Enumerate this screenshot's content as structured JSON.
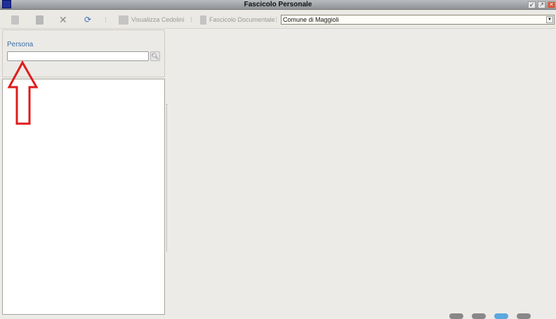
{
  "window": {
    "title": "Fascicolo Personale",
    "buttons": [
      "minimize",
      "maximize",
      "close"
    ]
  },
  "toolbar": {
    "new": "new-icon",
    "save": "save-icon",
    "delete": "delete-icon",
    "refresh": "refresh-icon",
    "visualizza_cedolini": "Visualizza Cedolini",
    "fascicolo_documentale": "Fascicolo Documentale",
    "ente": "Comune di Maggioli"
  },
  "left": {
    "persona_label": "Persona",
    "persona_value": ""
  },
  "annotation": {
    "color": "#e01b1b"
  }
}
